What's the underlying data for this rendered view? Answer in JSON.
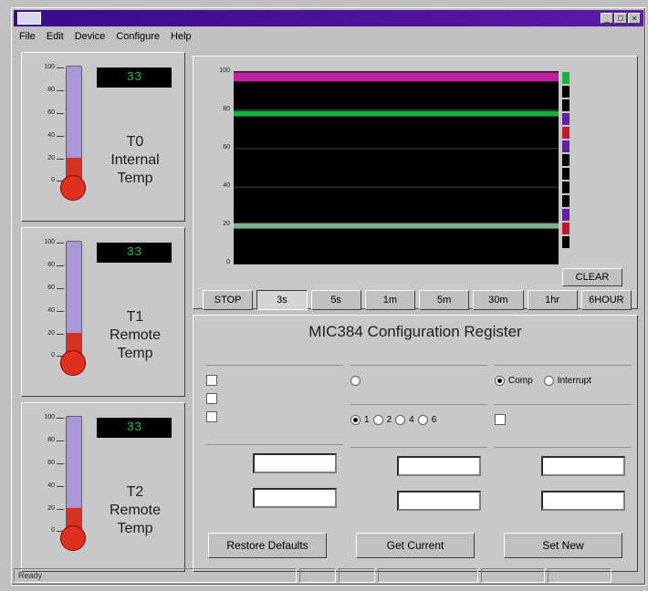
{
  "window": {
    "title": "",
    "icons": [
      "app-icon"
    ]
  },
  "menu": [
    "File",
    "Edit",
    "Device",
    "Configure",
    "Help"
  ],
  "thermometers": [
    {
      "reading": "33",
      "unit": "",
      "label_line1": "T0",
      "label_line2": "Internal",
      "label_line3": "Temp",
      "fill": 0.22
    },
    {
      "reading": "33",
      "unit": "",
      "label_line1": "T1",
      "label_line2": "Remote",
      "label_line3": "Temp",
      "fill": 0.22
    },
    {
      "reading": "33",
      "unit": "",
      "label_line1": "T2",
      "label_line2": "Remote",
      "label_line3": "Temp",
      "fill": 0.22
    }
  ],
  "scale_labels": [
    "100",
    "80",
    "60",
    "40",
    "20",
    "0"
  ],
  "chart": {
    "y_ticks": [
      "100",
      "80",
      "60",
      "40",
      "20",
      "0"
    ],
    "lines": [
      {
        "color": "#c020a0",
        "y": 97
      },
      {
        "color": "#18b040",
        "y": 78
      },
      {
        "color": "#7fb090",
        "y": 20
      }
    ],
    "legend": [
      {
        "label": "",
        "color": "#18b040"
      },
      {
        "label": "",
        "color": "#000000"
      },
      {
        "label": "",
        "color": "#000000"
      },
      {
        "label": "",
        "color": "#6020a0"
      },
      {
        "label": "",
        "color": "#c01830"
      },
      {
        "label": "",
        "color": "#6020a0"
      },
      {
        "label": "",
        "color": "#000000"
      },
      {
        "label": "",
        "color": "#000000"
      },
      {
        "label": "",
        "color": "#000000"
      },
      {
        "label": "",
        "color": "#000000"
      },
      {
        "label": "",
        "color": "#6020a0"
      },
      {
        "label": "",
        "color": "#c01830"
      },
      {
        "label": "",
        "color": "#000000"
      }
    ],
    "clear_label": "CLEAR",
    "span_buttons": [
      "STOP",
      "3s",
      "5s",
      "1m",
      "5m",
      "30m",
      "1hr",
      "6HOUR"
    ],
    "active_span": 1
  },
  "config": {
    "title": "MIC384 Configuration Register",
    "groups": {
      "interrupt_status": "",
      "int_polarity": "",
      "mode": "",
      "fault_queue": "",
      "shdn": "",
      "local_temp": "",
      "remote_temp1": "",
      "remote_temp2": ""
    },
    "status_options": [
      {
        "label": "",
        "checked": false
      },
      {
        "label": "",
        "checked": false
      },
      {
        "label": "",
        "checked": false
      }
    ],
    "polarity_option": "",
    "mode_options": [
      "Comp",
      "Interrupt"
    ],
    "fault_options": [
      "1",
      "2",
      "4",
      "6"
    ],
    "shdn_option": "",
    "setpoint_label": "",
    "hysteresis_label": "",
    "local_setpoint": "",
    "local_hyst": "",
    "remote1_setpoint": "",
    "remote1_hyst": "",
    "remote2_setpoint": "",
    "remote2_hyst": "",
    "buttons": [
      "Restore Defaults",
      "Get Current",
      "Set New"
    ]
  },
  "status": {
    "ready": "Ready",
    "cells": [
      "",
      "",
      "",
      "",
      ""
    ]
  }
}
